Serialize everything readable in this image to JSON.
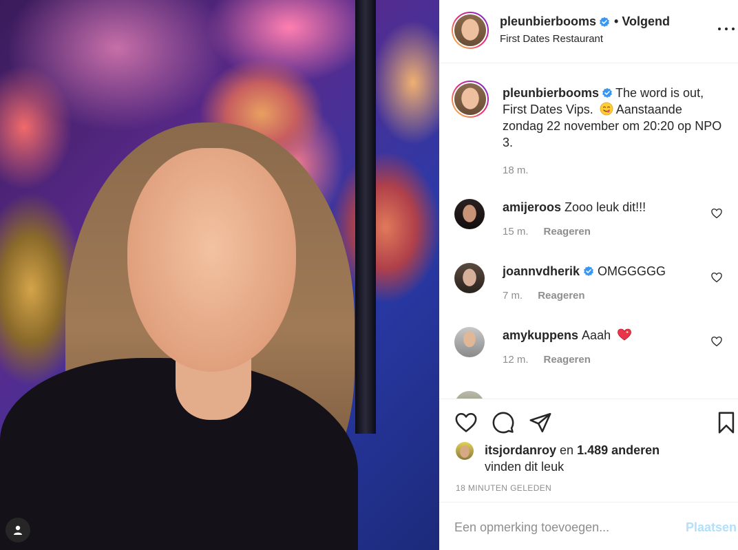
{
  "post": {
    "author": "pleunbierbooms",
    "follow_status": "• Volgend",
    "location": "First Dates Restaurant",
    "caption_line1": "The word is out, First Dates Vips.",
    "caption_line2": "Aanstaande zondag 22 november om 20:20 op NPO 3.",
    "caption_emoji": "face-savoring-food-emoji",
    "caption_time": "18 m."
  },
  "comments": [
    {
      "user": "amijeroos",
      "text": "Zooo leuk dit!!!",
      "time": "15 m.",
      "reply": "Reageren",
      "verified": false
    },
    {
      "user": "joannvdherik",
      "text": "OMGGGGG",
      "time": "7 m.",
      "reply": "Reageren",
      "verified": true
    },
    {
      "user": "amykuppens",
      "text": "Aaah",
      "time": "12 m.",
      "reply": "Reageren",
      "verified": false,
      "emoji": "sparkling-heart-emoji"
    }
  ],
  "likes": {
    "user": "itsjordanroy",
    "connector": "en",
    "others": "1.489 anderen",
    "suffix": "vinden dit leuk"
  },
  "timestamp": "18 MINUTEN GELEDEN",
  "add_comment": {
    "placeholder": "Een opmerking toevoegen...",
    "post_label": "Plaatsen"
  },
  "colors": {
    "verified": "#3897f0",
    "text": "#262626",
    "muted": "#8e8e8e",
    "post_disabled": "#b2dffc",
    "border": "#efefef"
  },
  "icons": [
    "heart-icon",
    "comment-icon",
    "share-icon",
    "bookmark-icon",
    "more-icon",
    "user-tag-icon",
    "verified-badge-icon"
  ]
}
